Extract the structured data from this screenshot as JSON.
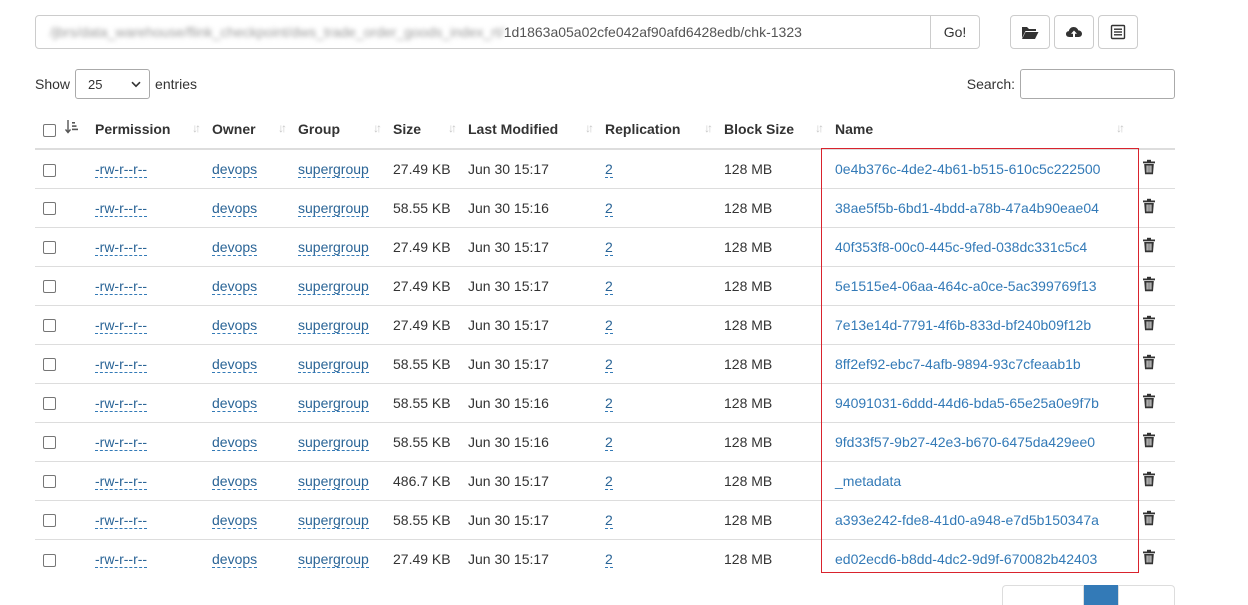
{
  "path": {
    "blurred_prefix": "/jbrs/data_warehouse/flink_checkpoint/dws_trade_order_goods_index_rt/",
    "visible_value": "1d1863a05a02cfe042af90afd6428edb/chk-1323",
    "go_label": "Go!"
  },
  "toolbar": {
    "icons": [
      "folder-open-icon",
      "cloud-upload-icon",
      "list-icon"
    ]
  },
  "length_menu": {
    "show_label": "Show",
    "selected": "25",
    "entries_label": "entries"
  },
  "search": {
    "label": "Search:",
    "value": ""
  },
  "table": {
    "columns": [
      "Permission",
      "Owner",
      "Group",
      "Size",
      "Last Modified",
      "Replication",
      "Block Size",
      "Name"
    ],
    "rows": [
      {
        "permission": "-rw-r--r--",
        "owner": "devops",
        "group": "supergroup",
        "size": "27.49 KB",
        "modified": "Jun 30 15:17",
        "replication": "2",
        "block_size": "128 MB",
        "name": "0e4b376c-4de2-4b61-b515-610c5c222500"
      },
      {
        "permission": "-rw-r--r--",
        "owner": "devops",
        "group": "supergroup",
        "size": "58.55 KB",
        "modified": "Jun 30 15:16",
        "replication": "2",
        "block_size": "128 MB",
        "name": "38ae5f5b-6bd1-4bdd-a78b-47a4b90eae04"
      },
      {
        "permission": "-rw-r--r--",
        "owner": "devops",
        "group": "supergroup",
        "size": "27.49 KB",
        "modified": "Jun 30 15:17",
        "replication": "2",
        "block_size": "128 MB",
        "name": "40f353f8-00c0-445c-9fed-038dc331c5c4"
      },
      {
        "permission": "-rw-r--r--",
        "owner": "devops",
        "group": "supergroup",
        "size": "27.49 KB",
        "modified": "Jun 30 15:17",
        "replication": "2",
        "block_size": "128 MB",
        "name": "5e1515e4-06aa-464c-a0ce-5ac399769f13"
      },
      {
        "permission": "-rw-r--r--",
        "owner": "devops",
        "group": "supergroup",
        "size": "27.49 KB",
        "modified": "Jun 30 15:17",
        "replication": "2",
        "block_size": "128 MB",
        "name": "7e13e14d-7791-4f6b-833d-bf240b09f12b"
      },
      {
        "permission": "-rw-r--r--",
        "owner": "devops",
        "group": "supergroup",
        "size": "58.55 KB",
        "modified": "Jun 30 15:17",
        "replication": "2",
        "block_size": "128 MB",
        "name": "8ff2ef92-ebc7-4afb-9894-93c7cfeaab1b"
      },
      {
        "permission": "-rw-r--r--",
        "owner": "devops",
        "group": "supergroup",
        "size": "58.55 KB",
        "modified": "Jun 30 15:16",
        "replication": "2",
        "block_size": "128 MB",
        "name": "94091031-6ddd-44d6-bda5-65e25a0e9f7b"
      },
      {
        "permission": "-rw-r--r--",
        "owner": "devops",
        "group": "supergroup",
        "size": "58.55 KB",
        "modified": "Jun 30 15:16",
        "replication": "2",
        "block_size": "128 MB",
        "name": "9fd33f57-9b27-42e3-b670-6475da429ee0"
      },
      {
        "permission": "-rw-r--r--",
        "owner": "devops",
        "group": "supergroup",
        "size": "486.7 KB",
        "modified": "Jun 30 15:17",
        "replication": "2",
        "block_size": "128 MB",
        "name": "_metadata"
      },
      {
        "permission": "-rw-r--r--",
        "owner": "devops",
        "group": "supergroup",
        "size": "58.55 KB",
        "modified": "Jun 30 15:17",
        "replication": "2",
        "block_size": "128 MB",
        "name": "a393e242-fde8-41d0-a948-e7d5b150347a"
      },
      {
        "permission": "-rw-r--r--",
        "owner": "devops",
        "group": "supergroup",
        "size": "27.49 KB",
        "modified": "Jun 30 15:17",
        "replication": "2",
        "block_size": "128 MB",
        "name": "ed02ecd6-b8dd-4dc2-9d9f-670082b42403"
      }
    ]
  },
  "colors": {
    "link": "#337ab7",
    "highlight_box": "#d9232d",
    "pager_active": "#337ab7"
  }
}
